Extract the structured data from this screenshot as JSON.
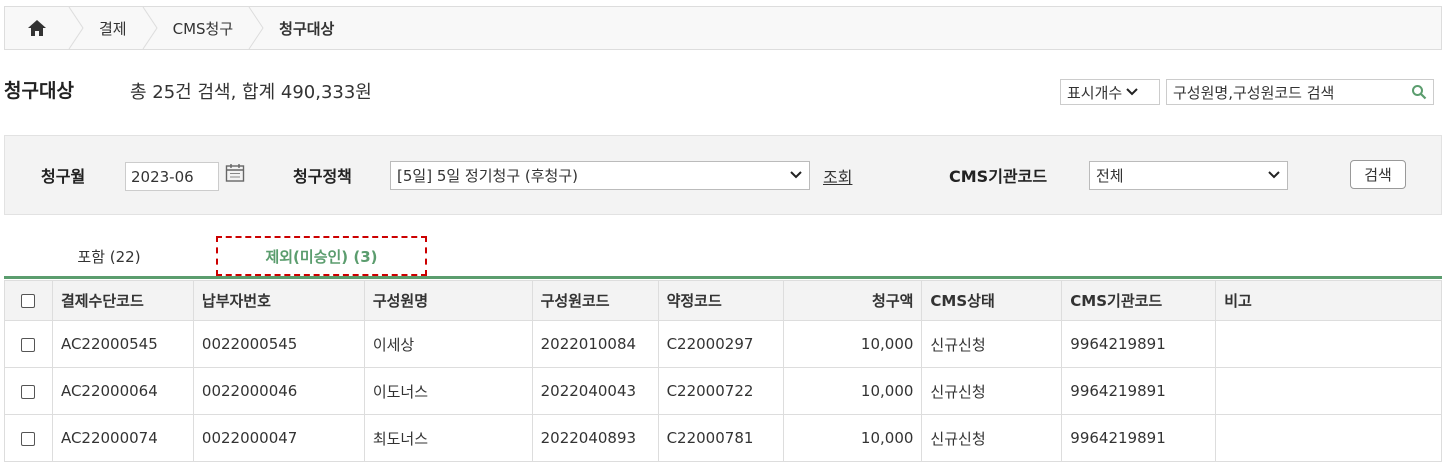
{
  "breadcrumb": {
    "items": [
      "결제",
      "CMS청구",
      "청구대상"
    ]
  },
  "title": {
    "text": "청구대상",
    "summary": "총 25건 검색, 합계 490,333원"
  },
  "toolbar": {
    "display_count_label": "표시개수",
    "search_value": "구성원명,구성원코드 검색"
  },
  "filter": {
    "month_label": "청구월",
    "month_value": "2023-06",
    "policy_label": "청구정책",
    "policy_value": "[5일] 5일 정기청구 (후청구)",
    "lookup_link": "조회",
    "agency_label": "CMS기관코드",
    "agency_value": "전체",
    "search_button": "검색"
  },
  "tabs": [
    {
      "label": "포함 (22)",
      "active": false
    },
    {
      "label": "제외(미승인) (3)",
      "active": true
    }
  ],
  "table": {
    "headers": [
      "결제수단코드",
      "납부자번호",
      "구성원명",
      "구성원코드",
      "약정코드",
      "청구액",
      "CMS상태",
      "CMS기관코드",
      "비고"
    ],
    "rows": [
      [
        "AC22000545",
        "0022000545",
        "이세상",
        "2022010084",
        "C22000297",
        "10,000",
        "신규신청",
        "9964219891",
        ""
      ],
      [
        "AC22000064",
        "0022000046",
        "이도너스",
        "2022040043",
        "C22000722",
        "10,000",
        "신규신청",
        "9964219891",
        ""
      ],
      [
        "AC22000074",
        "0022000047",
        "최도너스",
        "2022040893",
        "C22000781",
        "10,000",
        "신규신청",
        "9964219891",
        ""
      ]
    ]
  },
  "colors": {
    "accent": "#5b9d6e",
    "highlight_border": "#cc0000"
  }
}
